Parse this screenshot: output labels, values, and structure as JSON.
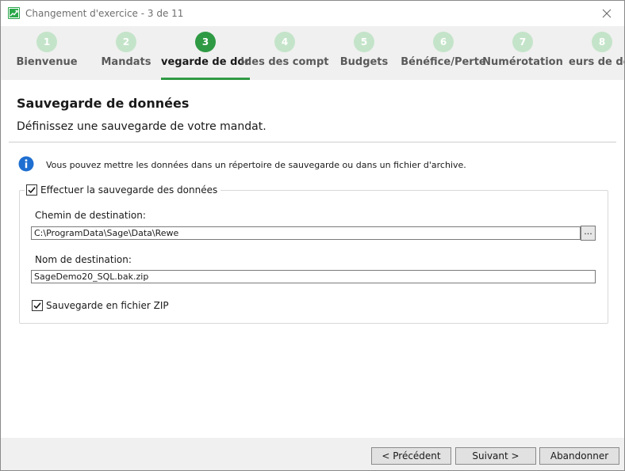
{
  "window": {
    "title": "Changement d'exercice - 3 de 11"
  },
  "steps": [
    {
      "number": "1",
      "label": "Bienvenue"
    },
    {
      "number": "2",
      "label": "Mandats"
    },
    {
      "number": "3",
      "label": "vegarde de donn"
    },
    {
      "number": "4",
      "label": "ldes des compt"
    },
    {
      "number": "5",
      "label": "Budgets"
    },
    {
      "number": "6",
      "label": "Bénéfice/Perte"
    },
    {
      "number": "7",
      "label": "Numérotation"
    },
    {
      "number": "8",
      "label": "eurs de dém"
    }
  ],
  "active_step": 3,
  "page": {
    "title": "Sauvegarde de données",
    "subtitle": "Définissez une sauvegarde de votre mandat.",
    "info": "Vous pouvez mettre les données dans un répertoire de sauvegarde ou dans un fichier d'archive."
  },
  "backup": {
    "enable_label": "Effectuer la sauvegarde des données",
    "enable_checked": true,
    "path_label": "Chemin de destination:",
    "path_value": "C:\\ProgramData\\Sage\\Data\\Rewe",
    "browse_label": "...",
    "name_label": "Nom de destination:",
    "name_value": "SageDemo20_SQL.bak.zip",
    "zip_label": "Sauvegarde en fichier ZIP",
    "zip_checked": true
  },
  "footer": {
    "prev_label": "< Précédent",
    "next_label": "Suivant >",
    "cancel_label": "Abandonner"
  },
  "colors": {
    "accent": "#2f9a44",
    "step_inactive": "#c4e4c9"
  }
}
